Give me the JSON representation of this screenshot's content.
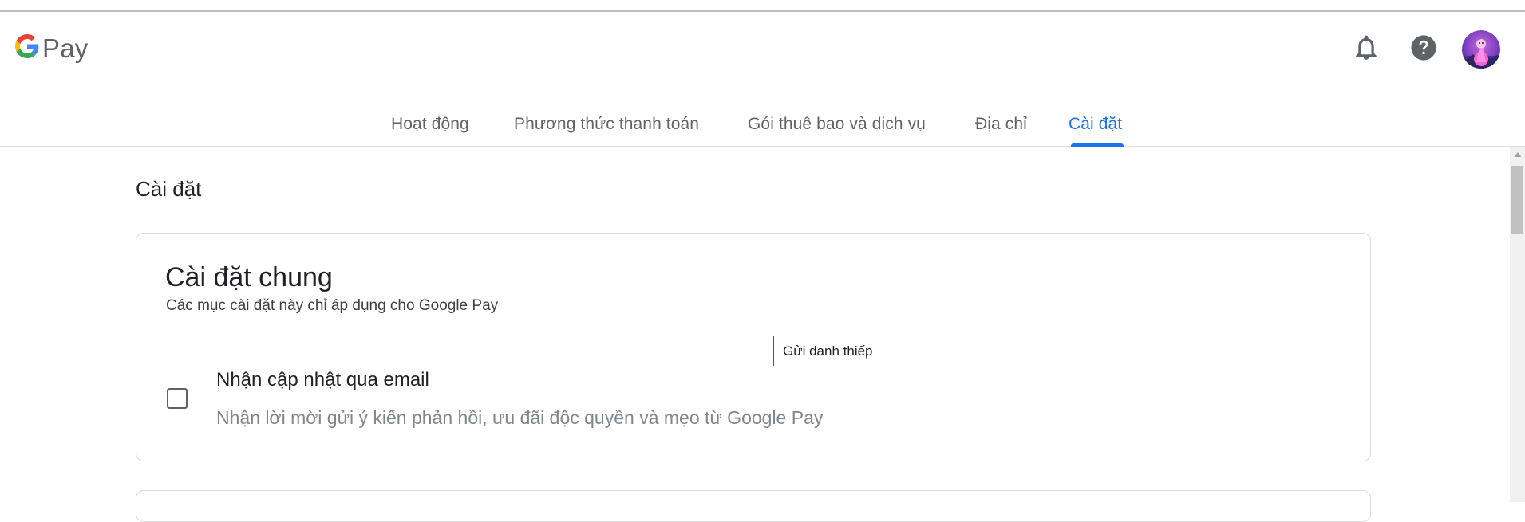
{
  "app": {
    "logo_text": "Pay",
    "logo_icon": "google-g-logo"
  },
  "header": {
    "icons": [
      "bell-icon",
      "help-icon",
      "avatar"
    ]
  },
  "tabs": [
    {
      "label": "Hoạt động",
      "active": false
    },
    {
      "label": "Phương thức thanh toán",
      "active": false
    },
    {
      "label": "Gói thuê bao và dịch vụ",
      "active": false
    },
    {
      "label": "Địa chỉ",
      "active": false
    },
    {
      "label": "Cài đặt",
      "active": true
    }
  ],
  "page": {
    "title": "Cài đặt"
  },
  "general_settings": {
    "title": "Cài đặt chung",
    "subtitle": "Các mục cài đặt này chỉ áp dụng cho Google Pay",
    "email_option": {
      "label": "Nhận cập nhật qua email",
      "description": "Nhận lời mời gửi ý kiến phản hồi, ưu đãi độc quyền và mẹo từ Google Pay",
      "checked": false
    }
  },
  "tooltip": {
    "text": "Gửi danh thiếp"
  },
  "colors": {
    "accent": "#1a73e8",
    "text_primary": "#202124",
    "text_secondary": "#5f6368",
    "border": "#dadce0"
  }
}
